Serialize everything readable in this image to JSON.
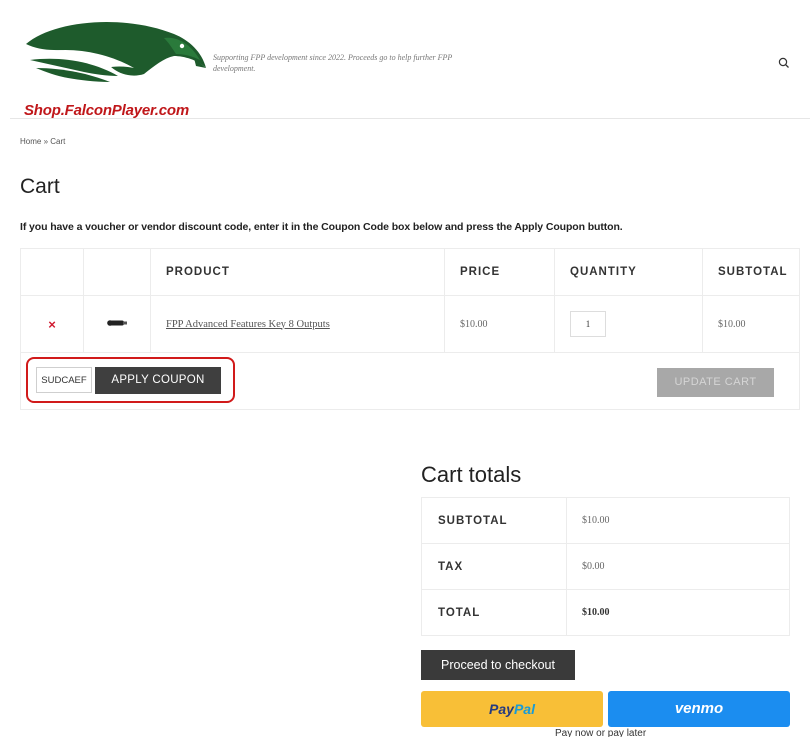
{
  "header": {
    "logo_text": "Shop.FalconPlayer.com",
    "tagline": "Supporting FPP development since 2022. Proceeds go to help further FPP development.",
    "search_icon": "search-icon"
  },
  "breadcrumb": {
    "home": "Home",
    "separator": "»",
    "current": "Cart"
  },
  "page_title": "Cart",
  "notice": "If you have a voucher or vendor discount code, enter it in the Coupon Code box below and press the Apply Coupon button.",
  "cart_table": {
    "headers": {
      "product": "PRODUCT",
      "price": "PRICE",
      "quantity": "QUANTITY",
      "subtotal": "SUBTOTAL"
    },
    "rows": [
      {
        "remove": "×",
        "product": "FPP Advanced Features Key 8 Outputs",
        "price": "$10.00",
        "quantity": "1",
        "subtotal": "$10.00"
      }
    ]
  },
  "coupon": {
    "value": "SUDCAEF",
    "apply_label": "APPLY COUPON"
  },
  "update_cart_label": "UPDATE CART",
  "totals": {
    "title": "Cart totals",
    "subtotal_label": "SUBTOTAL",
    "subtotal": "$10.00",
    "tax_label": "TAX",
    "tax": "$0.00",
    "total_label": "TOTAL",
    "total": "$10.00"
  },
  "checkout_label": "Proceed to checkout",
  "paypal": {
    "pay": "Pay",
    "pal": "Pal"
  },
  "venmo_label": "venmo",
  "pay_later": "Pay now or pay later",
  "colors": {
    "remove": "#d0192f",
    "highlight": "#d11a1a",
    "paypal": "#f8bf37",
    "venmo": "#1b8df0",
    "logo_green": "#1e5b2c",
    "logo_red": "#c0171a"
  }
}
